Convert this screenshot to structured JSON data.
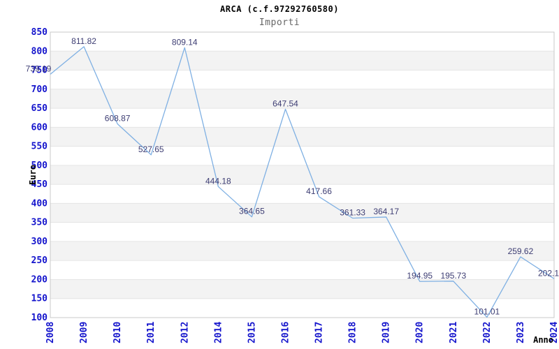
{
  "header": {
    "title": "ARCA (c.f.97292760580)",
    "subtitle": "Importi"
  },
  "chart_data": {
    "type": "line",
    "title": "ARCA (c.f.97292760580)",
    "subtitle": "Importi",
    "xlabel": "Anno",
    "ylabel": "Euro",
    "categories": [
      "2008",
      "2009",
      "2010",
      "2011",
      "2012",
      "2014",
      "2015",
      "2016",
      "2017",
      "2018",
      "2019",
      "2020",
      "2021",
      "2022",
      "2023",
      "2024"
    ],
    "values": [
      739.19,
      811.82,
      608.87,
      527.65,
      809.14,
      444.18,
      364.65,
      647.54,
      417.66,
      361.33,
      364.17,
      194.95,
      195.73,
      101.01,
      259.62,
      202.1
    ],
    "ylim": [
      100,
      850
    ],
    "ytick_step": 50,
    "grid": "horizontal gridlines with alternating gray bands",
    "legend": "none",
    "point_labels_visible": true,
    "x_tick_rotation_deg": -90,
    "colors": {
      "line": "#7fb0e3",
      "band": "#f3f3f3",
      "grid": "#e5e5e5",
      "plot_border": "#c9c9c9",
      "tick_label": "#1414cc",
      "data_label": "#3d3d73",
      "title": "#000000",
      "subtitle": "#666666",
      "axis_title": "#000000",
      "background": "#ffffff"
    }
  }
}
